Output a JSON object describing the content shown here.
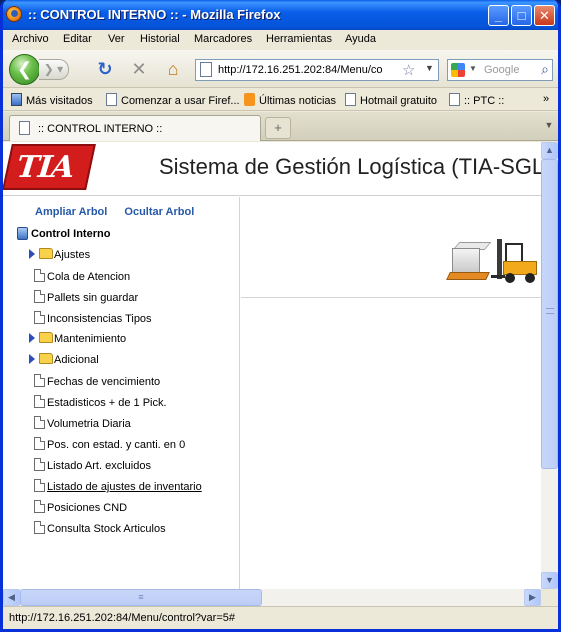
{
  "window": {
    "title": ":: CONTROL INTERNO :: - Mozilla Firefox",
    "minimize": "_",
    "maximize": "□",
    "close": "✕"
  },
  "menu": {
    "items": [
      "Archivo",
      "Editar",
      "Ver",
      "Historial",
      "Marcadores",
      "Herramientas",
      "Ayuda"
    ]
  },
  "nav": {
    "url": "http://172.16.251.202:84/Menu/co",
    "search_placeholder": "Google"
  },
  "bookmarks": {
    "items": [
      "Más visitados",
      "Comenzar a usar Firef...",
      "Últimas noticias",
      "Hotmail gratuito",
      ":: PTC ::"
    ],
    "overflow": "»"
  },
  "tabs": {
    "active_label": ":: CONTROL INTERNO ::",
    "new_tab": "+"
  },
  "header": {
    "logo_text": "TIA",
    "title": "Sistema de Gestión Logística (TIA-SGL)"
  },
  "tree": {
    "expand_label": "Ampliar Arbol",
    "collapse_label": "Ocultar Arbol",
    "root_label": "Control Interno",
    "items": [
      {
        "label": "Ajustes",
        "type": "folder"
      },
      {
        "label": "Cola de Atencion",
        "type": "doc"
      },
      {
        "label": "Pallets sin guardar",
        "type": "doc"
      },
      {
        "label": "Inconsistencias Tipos",
        "type": "doc"
      },
      {
        "label": "Mantenimiento",
        "type": "folder"
      },
      {
        "label": "Adicional",
        "type": "folder"
      },
      {
        "label": "Fechas de vencimiento",
        "type": "doc"
      },
      {
        "label": "Estadisticos + de 1 Pick.",
        "type": "doc"
      },
      {
        "label": "Volumetria Diaria",
        "type": "doc"
      },
      {
        "label": "Pos. con estad. y canti. en 0",
        "type": "doc"
      },
      {
        "label": "Listado Art. excluidos",
        "type": "doc"
      },
      {
        "label": "Listado de ajustes de inventario",
        "type": "doc",
        "hovered": true
      },
      {
        "label": "Posiciones CND",
        "type": "doc"
      },
      {
        "label": "Consulta Stock Articulos",
        "type": "doc"
      }
    ]
  },
  "status": {
    "text": "http://172.16.251.202:84/Menu/control?var=5#"
  },
  "colors": {
    "xp_blue": "#0a5ee8",
    "tia_red": "#d31c1c",
    "link_blue": "#2659a8",
    "pallet_orange": "#e48a25",
    "forklift_yellow": "#f2a91b"
  }
}
